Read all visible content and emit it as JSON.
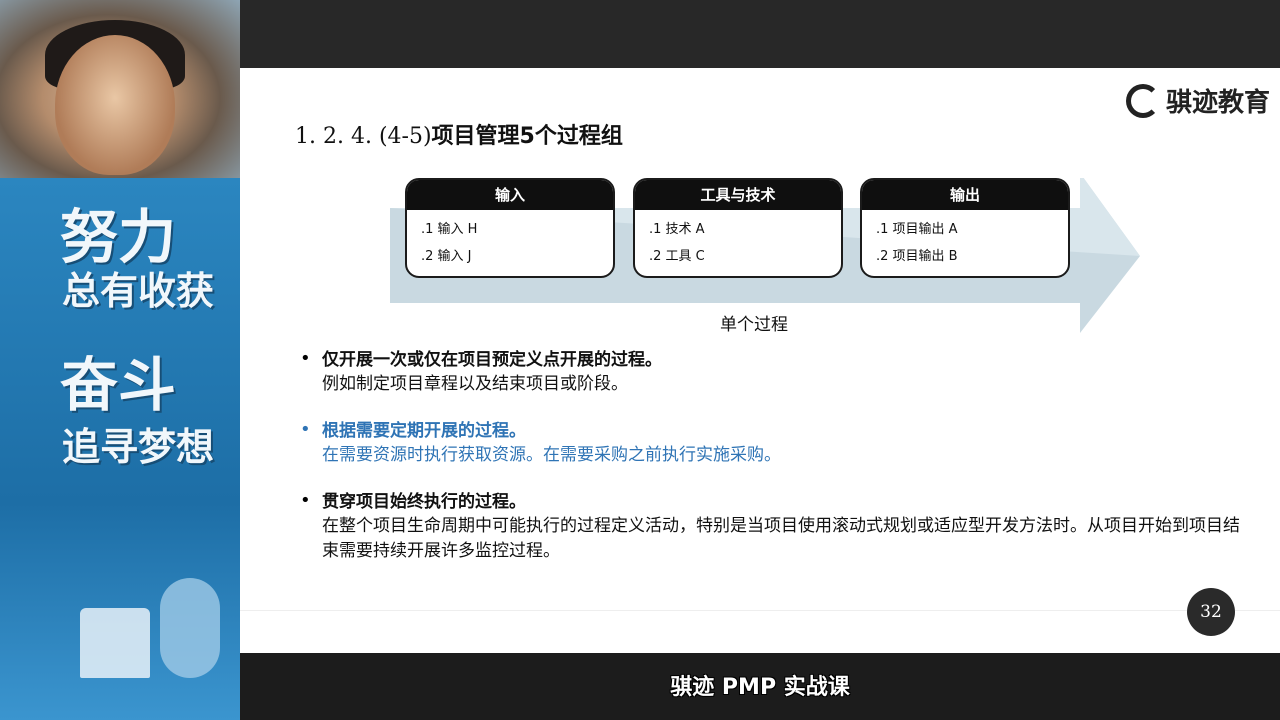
{
  "course_banner": {
    "title": "骐迹 PMP 实战课"
  },
  "logo": {
    "text": "骐迹教育",
    "icon": "brand-q-icon"
  },
  "poster": {
    "line1": "努力",
    "line2": "总有收获",
    "line3": "奋斗",
    "line4": "追寻梦想"
  },
  "slide": {
    "title_number": "1. 2. 4. (4-5)",
    "title_text": "项目管理5个过程组",
    "diagram": {
      "boxes": [
        {
          "header": "输入",
          "items": [
            ".1  输入 H",
            ".2  输入 J"
          ]
        },
        {
          "header": "工具与技术",
          "items": [
            ".1  技术 A",
            ".2  工具 C"
          ]
        },
        {
          "header": "输出",
          "items": [
            ".1  项目输出 A",
            ".2  项目输出 B"
          ]
        }
      ],
      "label": "单个过程"
    },
    "bullets": [
      {
        "head": "仅开展一次或仅在项目预定义点开展的过程。",
        "body": "例如制定项目章程以及结束项目或阶段。"
      },
      {
        "head": "根据需要定期开展的过程。",
        "body": "在需要资源时执行获取资源。在需要采购之前执行实施采购。"
      },
      {
        "head": "贯穿项目始终执行的过程。",
        "body": "在整个项目生命周期中可能执行的过程定义活动，特别是当项目使用滚动式规划或适应型开发方法时。从项目开始到项目结束需要持续开展许多监控过程。"
      }
    ],
    "page_number": "32"
  },
  "colors": {
    "accent_blue": "#2f74b5",
    "arrow_fill": "#c9d9e1"
  }
}
